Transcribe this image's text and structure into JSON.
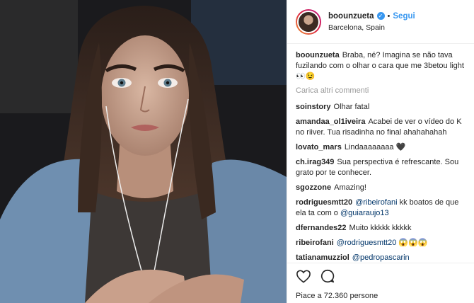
{
  "header": {
    "username": "boounzueta",
    "separator": "•",
    "follow_label": "Segui",
    "location": "Barcelona, Spain",
    "verified_glyph": "✓"
  },
  "caption": {
    "username": "boounzueta",
    "text": "Braba, né? Imagina se não tava fuzilando com o olhar o cara que me 3betou light 👀😉"
  },
  "load_more_label": "Carica altri commenti",
  "comments": [
    {
      "user": "soinstory",
      "text": "Olhar fatal"
    },
    {
      "user": "amandaa_ol1iveira",
      "text": "Acabei de ver o vídeo do K no riiver. Tua risadinha no final ahahahahah"
    },
    {
      "user": "lovato_mars",
      "text": "Lindaaaaaaaa 🖤"
    },
    {
      "user": "ch.irag349",
      "text": "Sua perspectiva é refrescante. Sou grato por te conhecer."
    },
    {
      "user": "sgozzone",
      "text": "Amazing!"
    },
    {
      "user": "rodriguesmtt20",
      "mention1": "@ribeirofani",
      "text": " kk boatos de que ela ta com o ",
      "mention2": "@guiaraujo13"
    },
    {
      "user": "dfernandes22",
      "text": "Muito kkkkk kkkkk"
    },
    {
      "user": "ribeirofani",
      "mention1": "@rodriguesmtt20",
      "text": " 😱😱😱"
    },
    {
      "user": "tatianamuzziol",
      "mention1": "@pedropascarin",
      "text": ""
    }
  ],
  "actions": {
    "like_icon": "heart-icon",
    "comment_icon": "comment-icon",
    "likes_text": "Piace a 72.360 persone"
  },
  "colors": {
    "accent": "#3897f0",
    "mention": "#003569",
    "muted": "#999999",
    "border": "#efefef"
  }
}
